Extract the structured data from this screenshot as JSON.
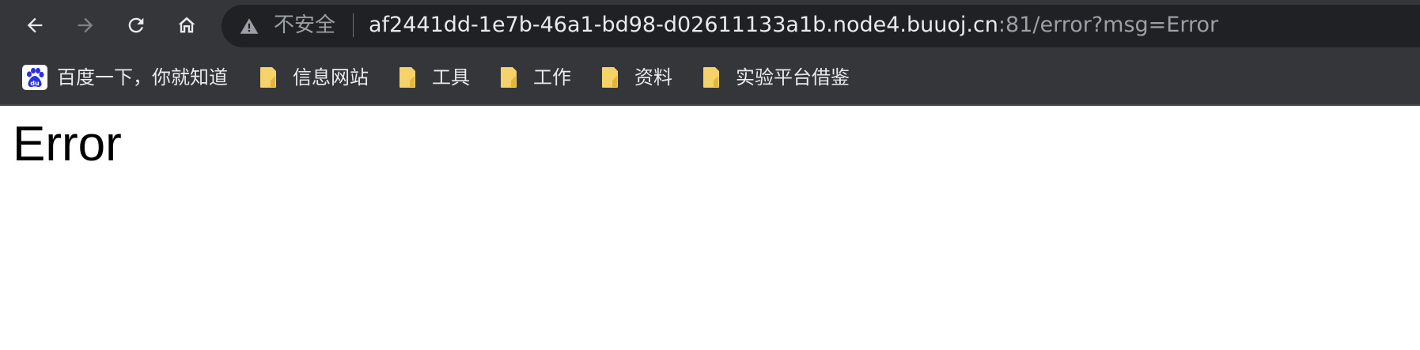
{
  "browser": {
    "security_label": "不安全",
    "url_host": "af2441dd-1e7b-46a1-bd98-d02611133a1b.node4.buuoj.cn",
    "url_rest": ":81/error?msg=Error"
  },
  "bookmarks": [
    {
      "label": "百度一下，你就知道",
      "icon": "baidu-icon"
    },
    {
      "label": "信息网站",
      "icon": "folder-icon"
    },
    {
      "label": "工具",
      "icon": "folder-icon"
    },
    {
      "label": "工作",
      "icon": "folder-icon"
    },
    {
      "label": "资料",
      "icon": "folder-icon"
    },
    {
      "label": "实验平台借鉴",
      "icon": "folder-icon"
    }
  ],
  "page": {
    "heading": "Error"
  },
  "colors": {
    "chrome_bg": "#35363a",
    "omnibox_bg": "#202124",
    "folder_yellow": "#f6d26b",
    "baidu_blue": "#2932e1"
  }
}
